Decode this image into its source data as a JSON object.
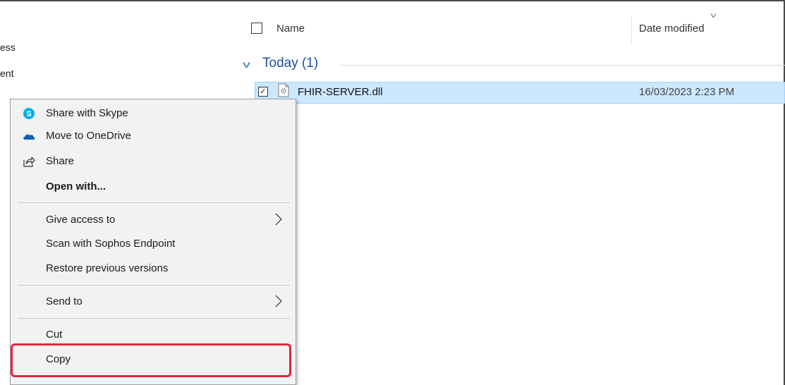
{
  "nav": {
    "items": [
      "ess",
      "ent"
    ]
  },
  "headers": {
    "name": "Name",
    "date_modified": "Date modified"
  },
  "group": {
    "label": "Today (1)"
  },
  "file": {
    "name": "FHIR-SERVER.dll",
    "date": "16/03/2023 2:23 PM",
    "selected": true,
    "checked_glyph": "✓"
  },
  "context_menu": {
    "share_skype": "Share with Skype",
    "move_onedrive": "Move to OneDrive",
    "share": "Share",
    "open_with": "Open with...",
    "give_access": "Give access to",
    "scan_sophos": "Scan with Sophos Endpoint",
    "restore_versions": "Restore previous versions",
    "send_to": "Send to",
    "cut": "Cut",
    "copy": "Copy"
  },
  "icons": {
    "skype": "skype-icon",
    "onedrive": "onedrive-icon",
    "share": "share-icon",
    "file": "dll-file-icon",
    "submenu": "chevron-right-icon"
  },
  "colors": {
    "selection_bg": "#cce8ff",
    "group_label": "#1e4fa0",
    "skype_blue": "#00aff0",
    "onedrive_blue": "#0364b8",
    "highlight_red": "#e0283c"
  }
}
